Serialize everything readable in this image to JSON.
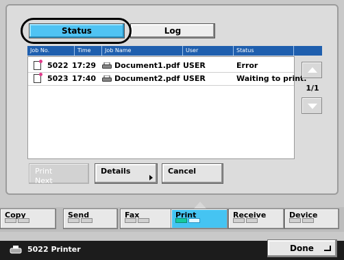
{
  "tabs": {
    "status": "Status",
    "log": "Log"
  },
  "columns": [
    "Job No.",
    "Time",
    "Job Name",
    "User",
    "Status"
  ],
  "jobs": [
    {
      "job_no": "5022",
      "time": "17:29",
      "job_name": "Document1.pdf",
      "user": "USER",
      "status": "Error"
    },
    {
      "job_no": "5023",
      "time": "17:40",
      "job_name": "Document2.pdf",
      "user": "USER",
      "status": "Waiting to print."
    }
  ],
  "pager": {
    "page": "1/1"
  },
  "buttons": {
    "print_next_1": "Print",
    "print_next_2": "Next",
    "details": "Details",
    "cancel": "Cancel",
    "done": "Done"
  },
  "main_tabs": [
    {
      "label": "Copy"
    },
    {
      "label": "Send"
    },
    {
      "label": "Fax"
    },
    {
      "label": "Print"
    },
    {
      "label": "Receive"
    },
    {
      "label": "Device"
    }
  ],
  "status_bar": {
    "text": "5022  Printer"
  },
  "icons": {
    "doc": "document-icon",
    "printer": "printer-icon",
    "up": "arrow-up-icon",
    "down": "arrow-down-icon"
  },
  "colors": {
    "accent": "#4fc3f3",
    "header": "#1f5fae"
  }
}
